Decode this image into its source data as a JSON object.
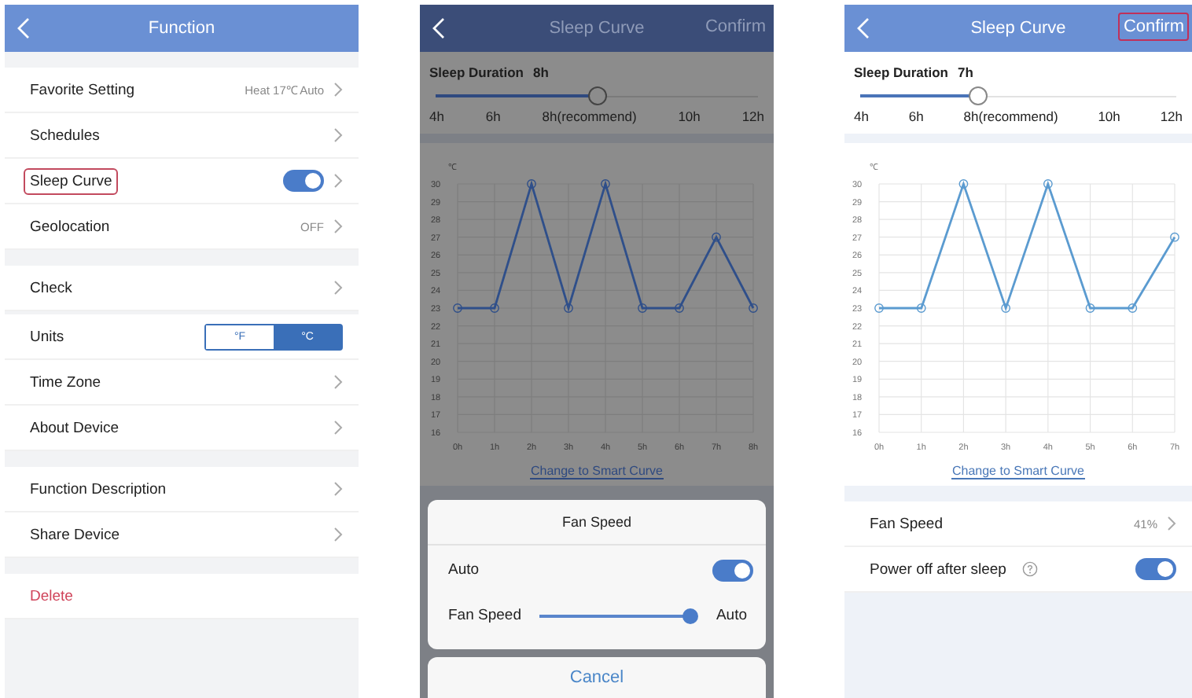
{
  "function_screen": {
    "title": "Function",
    "groups": [
      {
        "items": [
          {
            "kind": "value",
            "label": "Favorite Setting",
            "value": "Heat 17℃ Auto",
            "highlighted": false
          },
          {
            "kind": "link",
            "label": "Schedules",
            "highlighted": false
          },
          {
            "kind": "toggle",
            "label": "Sleep Curve",
            "on": true,
            "highlighted": true
          },
          {
            "kind": "value",
            "label": "Geolocation",
            "value": "OFF",
            "highlighted": false
          }
        ]
      },
      {
        "items": [
          {
            "kind": "link",
            "label": "Check",
            "highlighted": false
          }
        ]
      },
      {
        "items": [
          {
            "kind": "units",
            "label": "Units",
            "options": [
              {
                "label": "°F",
                "selected": false
              },
              {
                "label": "°C",
                "selected": true
              }
            ],
            "highlighted": false
          },
          {
            "kind": "link",
            "label": "Time Zone",
            "highlighted": false
          },
          {
            "kind": "link",
            "label": "About Device",
            "highlighted": false
          }
        ]
      },
      {
        "items": [
          {
            "kind": "link",
            "label": "Function Description",
            "highlighted": false
          },
          {
            "kind": "link",
            "label": "Share Device",
            "highlighted": false
          }
        ]
      },
      {
        "items": [
          {
            "kind": "danger",
            "label": "Delete",
            "highlighted": false
          }
        ]
      }
    ]
  },
  "sleep_screens": [
    {
      "title": "Sleep Curve",
      "confirm": "Confirm",
      "confirm_highlighted": false,
      "dimmed": true,
      "duration_label": "Sleep Duration",
      "duration_value": "8h",
      "level": 0.5,
      "scale": [
        "4h",
        "6h",
        "8h(recommend)",
        "10h",
        "12h"
      ],
      "chart_data": {
        "type": "line",
        "grid": true,
        "ylabel": "℃",
        "categories": [
          "0h",
          "1h",
          "2h",
          "3h",
          "4h",
          "5h",
          "6h",
          "7h",
          "8h"
        ],
        "ylim": [
          16,
          30
        ],
        "yticks": [
          16,
          17,
          18,
          19,
          20,
          21,
          22,
          23,
          24,
          25,
          26,
          27,
          28,
          29,
          30
        ],
        "series": [
          {
            "color": "#2f4f8a",
            "marker": true,
            "values": [
              23,
              23,
              30,
              23,
              30,
              23,
              23,
              27,
              23
            ]
          }
        ]
      },
      "link": "Change to Smart Curve",
      "sheet": {
        "title": "Fan Speed",
        "auto_label": "Auto",
        "auto_on": true,
        "slider_label": "Fan Speed",
        "level": 0.96,
        "slider_value": "Auto",
        "cancel": "Cancel"
      }
    },
    {
      "title": "Sleep Curve",
      "confirm": "Confirm",
      "confirm_highlighted": true,
      "dimmed": false,
      "duration_label": "Sleep Duration",
      "duration_value": "7h",
      "level": 0.375,
      "scale": [
        "4h",
        "6h",
        "8h(recommend)",
        "10h",
        "12h"
      ],
      "chart_data": {
        "type": "line",
        "grid": true,
        "ylabel": "℃",
        "categories": [
          "0h",
          "1h",
          "2h",
          "3h",
          "4h",
          "5h",
          "6h",
          "7h"
        ],
        "ylim": [
          16,
          30
        ],
        "yticks": [
          16,
          17,
          18,
          19,
          20,
          21,
          22,
          23,
          24,
          25,
          26,
          27,
          28,
          29,
          30
        ],
        "series": [
          {
            "color": "#5b9bd0",
            "marker": true,
            "values": [
              23,
              23,
              30,
              23,
              30,
              23,
              23,
              27
            ]
          }
        ]
      },
      "link": "Change to Smart Curve",
      "rows": [
        {
          "kind": "value",
          "label": "Fan Speed",
          "value": "41%"
        },
        {
          "kind": "help_toggle",
          "label": "Power off after sleep",
          "on": true
        }
      ]
    }
  ]
}
